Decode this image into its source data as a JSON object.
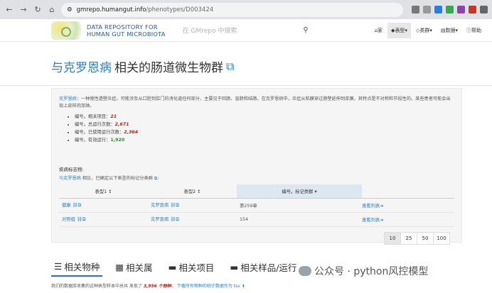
{
  "browser": {
    "url_host": "gmrepo.humangut.info",
    "url_path": "/phenotypes/D003424"
  },
  "header": {
    "logo_line1": "DATA REPOSITORY FOR",
    "logo_line2": "HUMAN GUT MICROBIOTA",
    "search_placeholder": "在 GMrepo 中搜索",
    "menu": [
      "家",
      "表型",
      "类群",
      "数据",
      "帮助"
    ]
  },
  "page": {
    "title_hl": "与克罗恩病",
    "title_rest": " 相关的肠道微生物群"
  },
  "desc": {
    "link": "克罗恩病",
    "text": "：一种慢性透壁炎症，可能涉及从口腔到肛门的消化道任何部分，主要见于回肠、盲肠和结肠。在克罗恩病中，炎症从粘膜穿过肠壁延伸到浆膜，其特点是不对称和节段性的。某些患者可能会出现上皮样肉芽肿。"
  },
  "stats": [
    {
      "label": "编号。相关项目：",
      "value": "21",
      "cls": "r1"
    },
    {
      "label": "编号。总运行次数：",
      "value": "2,671",
      "cls": "r1"
    },
    {
      "label": "编号。已使用运行次数：",
      "value": "2,364",
      "cls": "r1"
    },
    {
      "label": "编号。有效运行：",
      "value": "1,920",
      "cls": "r2"
    }
  ],
  "markers": {
    "title": "疾病标志物:",
    "sub_link": "与克罗恩病",
    "sub_text": " 相比，已确定以下表型的标记分类群 ",
    "headers": [
      "表型1 ↕",
      "表型2 ↕",
      "编号。标记类群 ▾",
      ""
    ],
    "rows": [
      {
        "p1": "健康",
        "p2": "克罗恩病",
        "n": "第259章",
        "act": "查看列表"
      },
      {
        "p1": "对照组",
        "p2": "克罗恩病",
        "n": "154",
        "act": "查看列表"
      }
    ]
  },
  "pager": [
    "10",
    "25",
    "50",
    "100"
  ],
  "tabs": [
    "相关物种",
    "相关属",
    "相关项目",
    "相关样品/运行"
  ],
  "footer": {
    "a": "我们的数据库收集的这种表型样本中总共 发现了 ",
    "n": "3,956 个物种",
    "b": "。 ",
    "link": "下载所有物种的统计数据作为 tsv"
  },
  "watermark": "公众号 · python风控模型"
}
